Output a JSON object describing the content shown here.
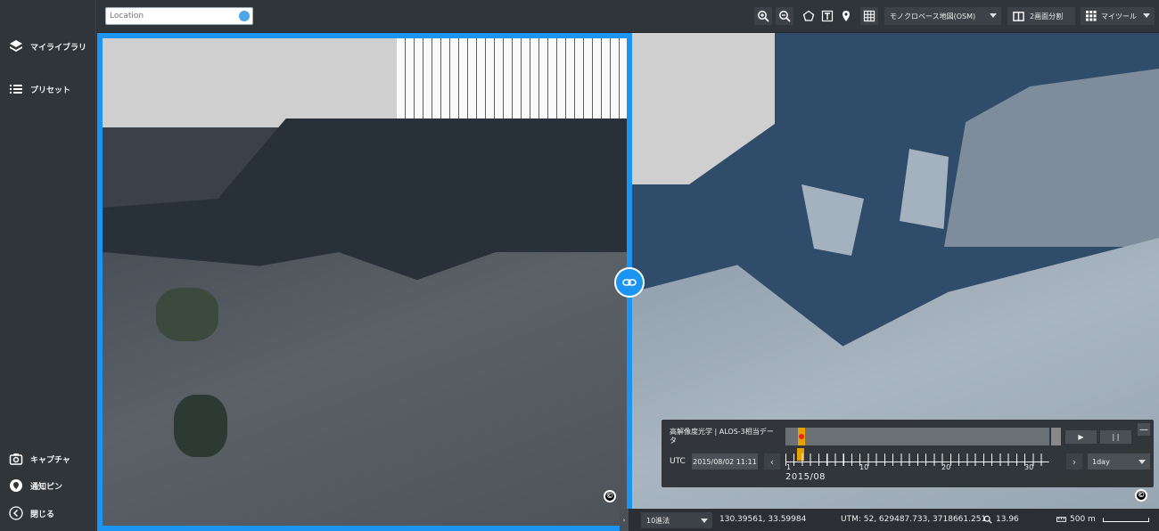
{
  "sidebar": {
    "my_library": "マイライブラリ",
    "presets": "プリセット",
    "capture": "キャプチャ",
    "notify_pin": "通知ピン",
    "close": "閉じる"
  },
  "search": {
    "placeholder": "Location"
  },
  "toolbar": {
    "basemap": "モノクロベース地図(OSM)",
    "split": "2画面分割",
    "my_tools": "マイツール"
  },
  "time_panel": {
    "title": "高解像度光学 | ALOS-3相当データ",
    "play": "▶",
    "pause": "| |",
    "minimize": "—",
    "utc_label": "UTC",
    "datetime": "2015/08/02 11:11",
    "tick_labels": [
      "1",
      "10",
      "20",
      "30"
    ],
    "month": "2015/08",
    "interval": "1day"
  },
  "status": {
    "coord_format": "10進法",
    "latlon": "130.39561, 33.59984",
    "utm": "UTM: 52, 629487.733, 3718661.251",
    "zoom": "13.96",
    "scale": "500 m"
  },
  "icons": {
    "copyright": "©"
  }
}
